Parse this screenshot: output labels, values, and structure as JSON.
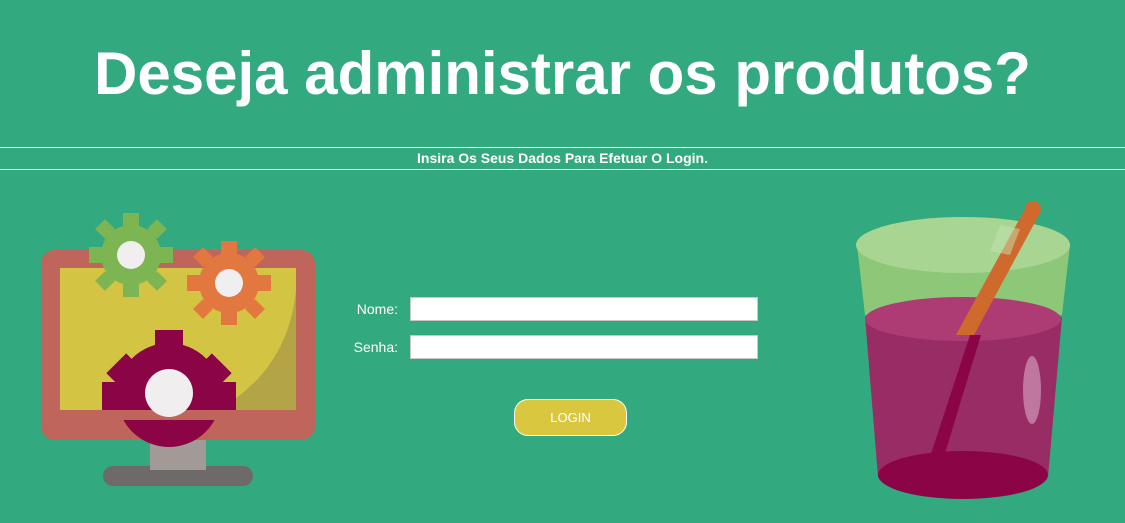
{
  "header": {
    "title": "Deseja administrar os produtos?",
    "subtitle": "Insira Os Seus Dados Para Efetuar O Login."
  },
  "login_form": {
    "name_label": "Nome:",
    "name_value": "",
    "password_label": "Senha:",
    "password_value": "",
    "submit_label": "LOGIN"
  },
  "illustrations": {
    "left_icon": "computer-gears-icon",
    "right_icon": "juice-glass-icon"
  },
  "colors": {
    "background": "#32a97f",
    "text": "#ffffff",
    "button": "#d9c83f",
    "monitor_frame": "#c0655b",
    "monitor_screen": "#d3c543",
    "gear_green": "#7db553",
    "gear_orange": "#e2773f",
    "gear_dark": "#8b0446",
    "glass_top": "#a8d28e",
    "juice": "#a93a73",
    "straw": "#d06a2c"
  }
}
